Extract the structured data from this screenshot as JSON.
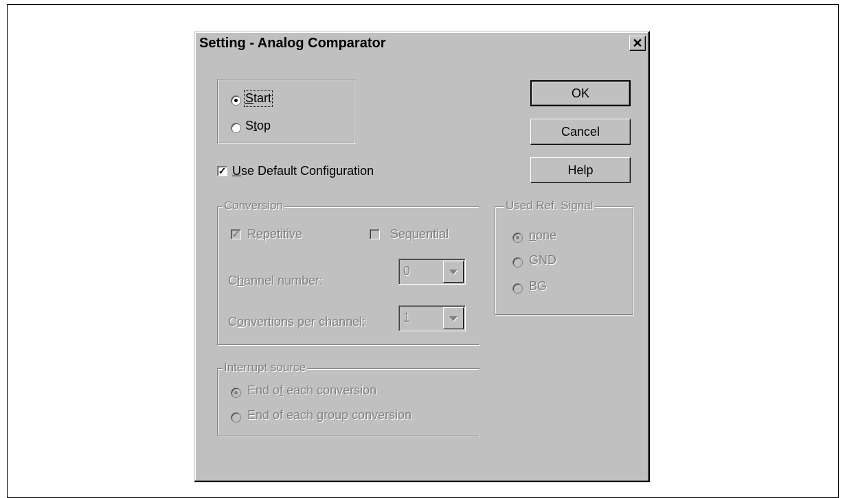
{
  "dialog": {
    "title": "Setting - Analog Comparator",
    "close_symbol": "✕"
  },
  "run_mode": {
    "start_label": "Start",
    "start_selected": true,
    "stop_label": "Stop",
    "stop_selected": false
  },
  "buttons": {
    "ok": "OK",
    "cancel": "Cancel",
    "help": "Help"
  },
  "use_default": {
    "label": "Use Default Configuration",
    "checked": true
  },
  "conversion": {
    "legend": "Conversion",
    "repetitive_label": "Repetitive",
    "repetitive_checked": true,
    "sequential_label": "Sequential",
    "sequential_checked": false,
    "channel_number_label": "Channel number:",
    "channel_number_value": "0",
    "conversions_label": "Convertions per channel:",
    "conversions_value": "1"
  },
  "ref_signal": {
    "legend": "Used Ref. Signal",
    "options": [
      {
        "label": "none",
        "selected": true
      },
      {
        "label": "GND",
        "selected": false
      },
      {
        "label": "BG",
        "selected": false
      }
    ]
  },
  "interrupt": {
    "legend": "Interrupt source",
    "each_conversion": "End of each conversion",
    "each_conversion_selected": true,
    "group_conversion": "End of each group conversion",
    "group_conversion_selected": false
  },
  "colors": {
    "dialog_face": "#c0c0c0",
    "disabled_text": "#808080"
  },
  "icons": {
    "close": "close-icon",
    "dropdown": "chevron-down-icon"
  }
}
